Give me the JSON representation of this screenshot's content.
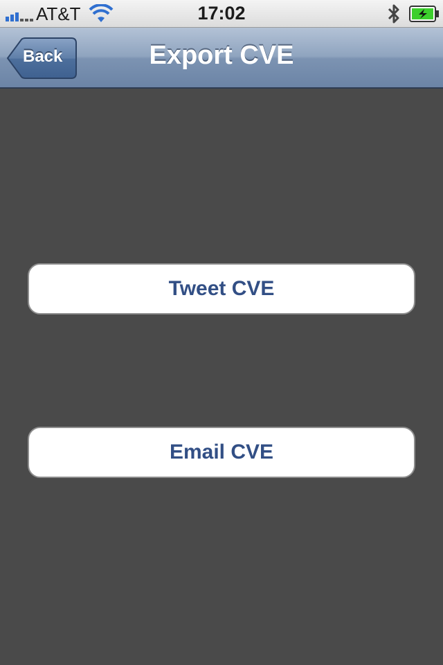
{
  "status_bar": {
    "carrier": "AT&T",
    "time": "17:02",
    "icons": [
      "signal-icon",
      "wifi-icon",
      "bluetooth-icon",
      "battery-charging-icon"
    ]
  },
  "nav_bar": {
    "back_label": "Back",
    "title": "Export CVE"
  },
  "actions": {
    "tweet_label": "Tweet CVE",
    "email_label": "Email CVE"
  },
  "colors": {
    "background": "#4a4a4a",
    "nav_bar": "#7c93b2",
    "button_text": "#324f85",
    "battery_fill": "#3ccf2c"
  }
}
